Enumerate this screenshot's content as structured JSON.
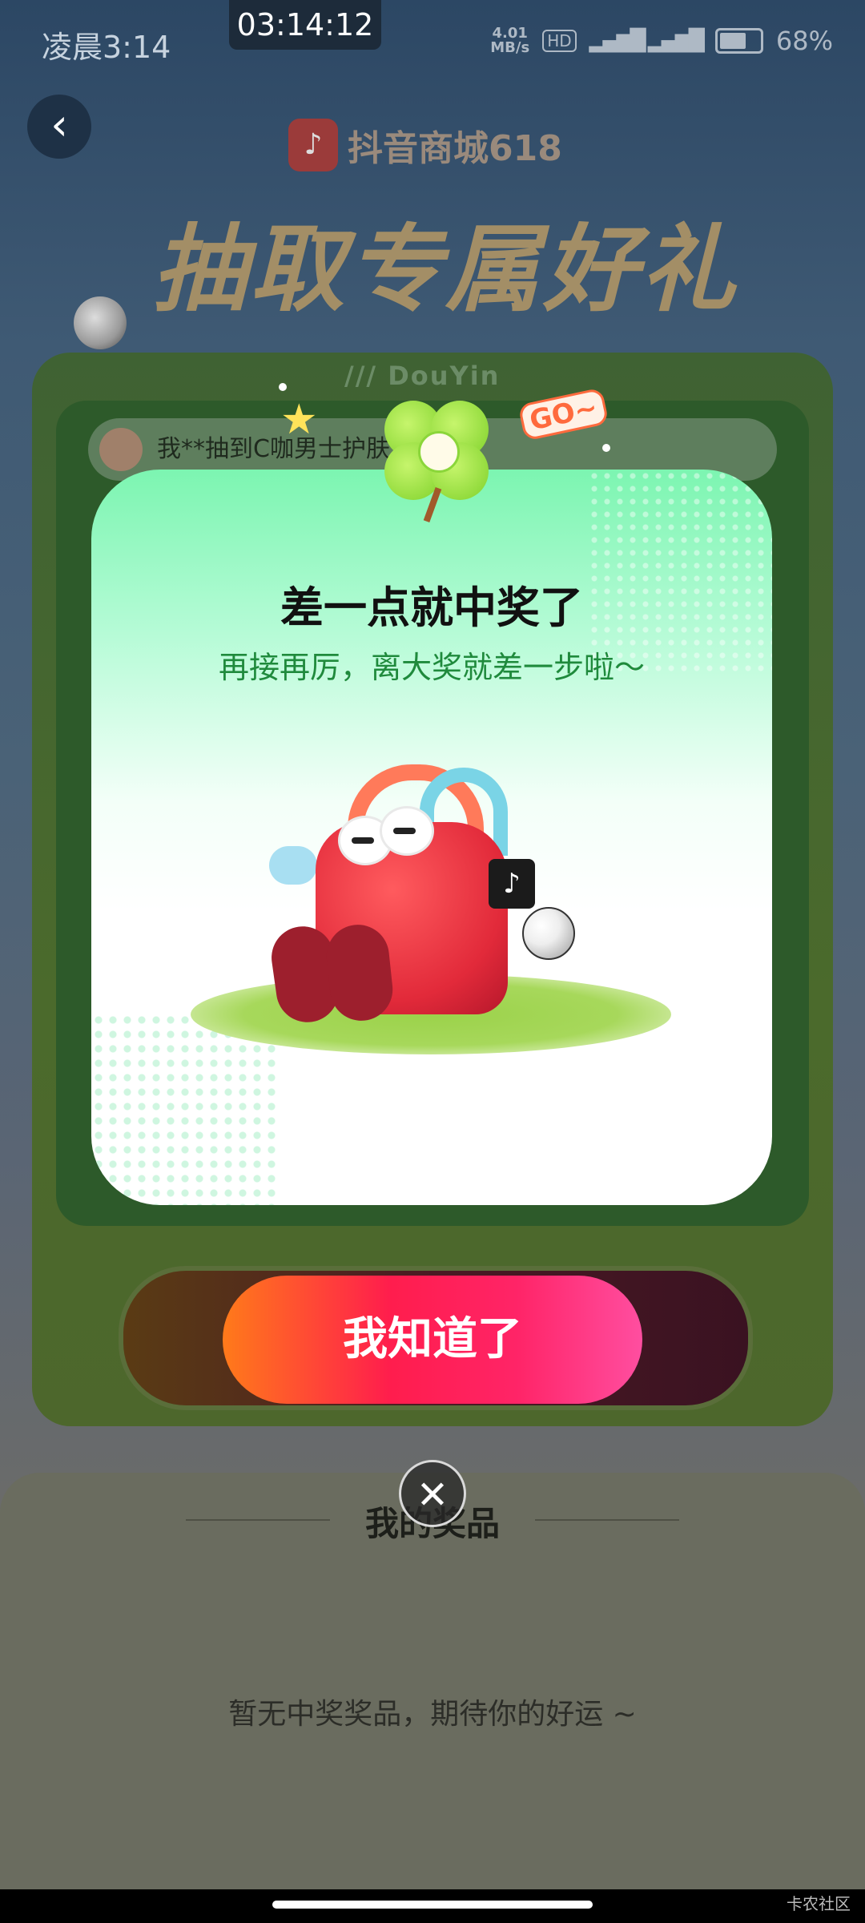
{
  "status_bar": {
    "time": "凌晨3:14",
    "recording_clock": "03:14:12",
    "net_speed": "4.01\nMB/s",
    "hd": "HD",
    "signal": "5G 4G",
    "battery": "68%"
  },
  "header": {
    "back_icon": "chevron-left-icon",
    "brand": "抖音商城618",
    "headline": "抽取专属好礼"
  },
  "background": {
    "watermark": "/// DouYin",
    "ticker_text": "我**抽到C咖男士护肤",
    "prizes_title": "我的奖品",
    "prizes_empty": "暂无中奖奖品，期待你的好运 ~"
  },
  "modal": {
    "title": "差一点就中奖了",
    "subtitle": "再接再厉，离大奖就差一步啦～",
    "go_badge": "GO~",
    "tag_icon": "douyin-logo-icon"
  },
  "actions": {
    "ok_label": "我知道了",
    "close_icon": "close-icon"
  },
  "footer": {
    "corner_mark": "卡农社区"
  }
}
